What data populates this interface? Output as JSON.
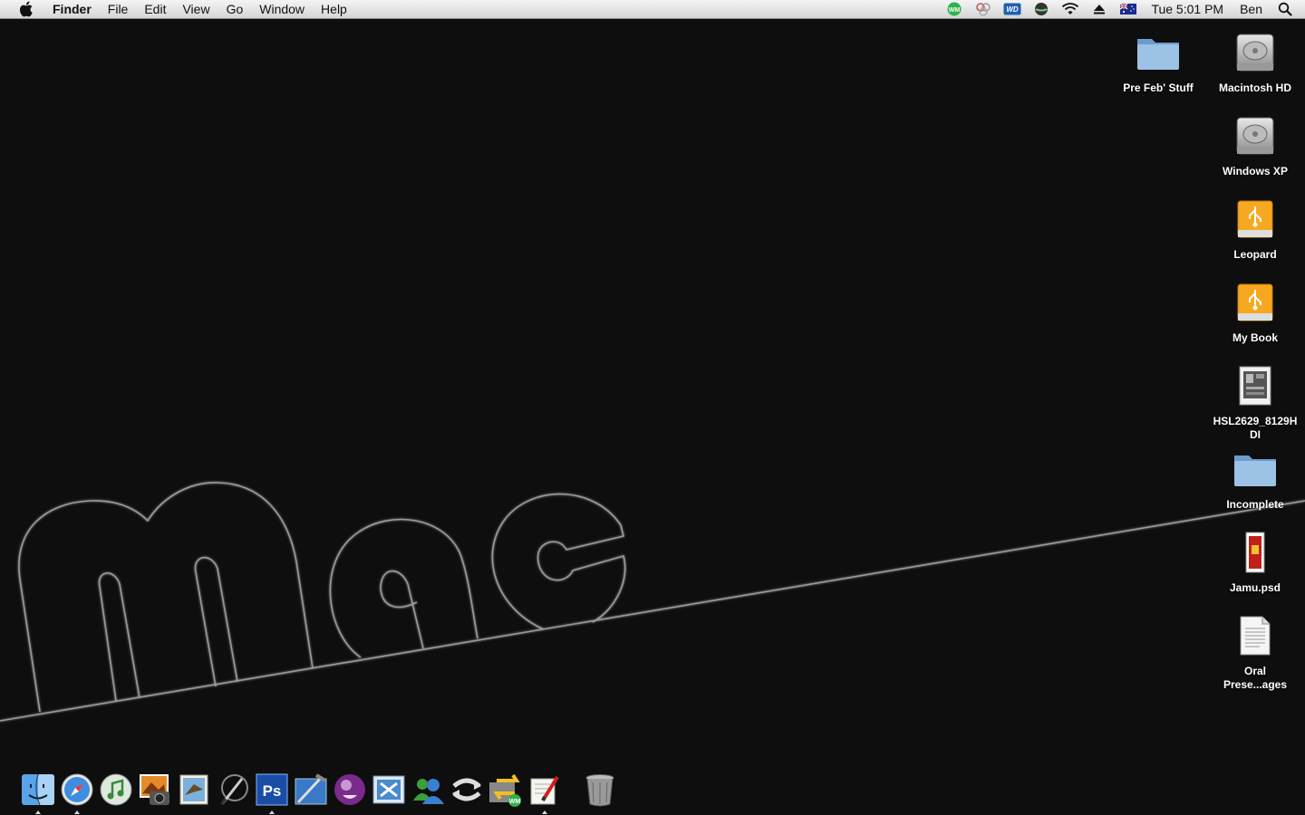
{
  "menubar": {
    "app_name": "Finder",
    "menus": [
      "File",
      "Edit",
      "View",
      "Go",
      "Window",
      "Help"
    ],
    "status_icons": [
      "wm-icon",
      "linked-circles-icon",
      "wd-icon",
      "globe-icon",
      "wifi-icon",
      "eject-icon",
      "australia-flag-icon"
    ],
    "clock": "Tue 5:01 PM",
    "user": "Ben"
  },
  "desktop": {
    "icons": [
      {
        "label": "Macintosh HD",
        "icon": "hard-drive-icon"
      },
      {
        "label": "Pre Feb' Stuff",
        "icon": "folder-icon"
      },
      {
        "label": "Windows XP",
        "icon": "hard-drive-icon"
      },
      {
        "label": "Leopard",
        "icon": "usb-drive-icon"
      },
      {
        "label": "My Book",
        "icon": "usb-drive-icon"
      },
      {
        "label": "HSL2629_8129HDI",
        "icon": "document-image-icon"
      },
      {
        "label": "Incomplete",
        "icon": "folder-icon"
      },
      {
        "label": "Jamu.psd",
        "icon": "psd-file-icon"
      },
      {
        "label": "Oral Prese...ages",
        "icon": "text-document-icon"
      }
    ]
  },
  "dock": {
    "apps": [
      {
        "name": "finder-icon",
        "running": true
      },
      {
        "name": "safari-icon",
        "running": true
      },
      {
        "name": "itunes-icon",
        "running": false
      },
      {
        "name": "iphoto-icon",
        "running": false
      },
      {
        "name": "mail-icon",
        "running": false
      },
      {
        "name": "pen-app-icon",
        "running": false
      },
      {
        "name": "photoshop-icon",
        "running": true
      },
      {
        "name": "xcode-icon",
        "running": false
      },
      {
        "name": "purple-app-icon",
        "running": false
      },
      {
        "name": "interface-builder-icon",
        "running": false
      },
      {
        "name": "messenger-icon",
        "running": false
      },
      {
        "name": "sync-icon",
        "running": false
      },
      {
        "name": "wm-transfer-icon",
        "running": false
      },
      {
        "name": "textedit-icon",
        "running": true
      }
    ],
    "trash": "trash-icon"
  },
  "colors": {
    "background": "#0e0e0e",
    "wallpaper_stroke": "#9a9a9a",
    "folder_blue": "#8ab4d8",
    "usb_orange": "#f7a821"
  }
}
